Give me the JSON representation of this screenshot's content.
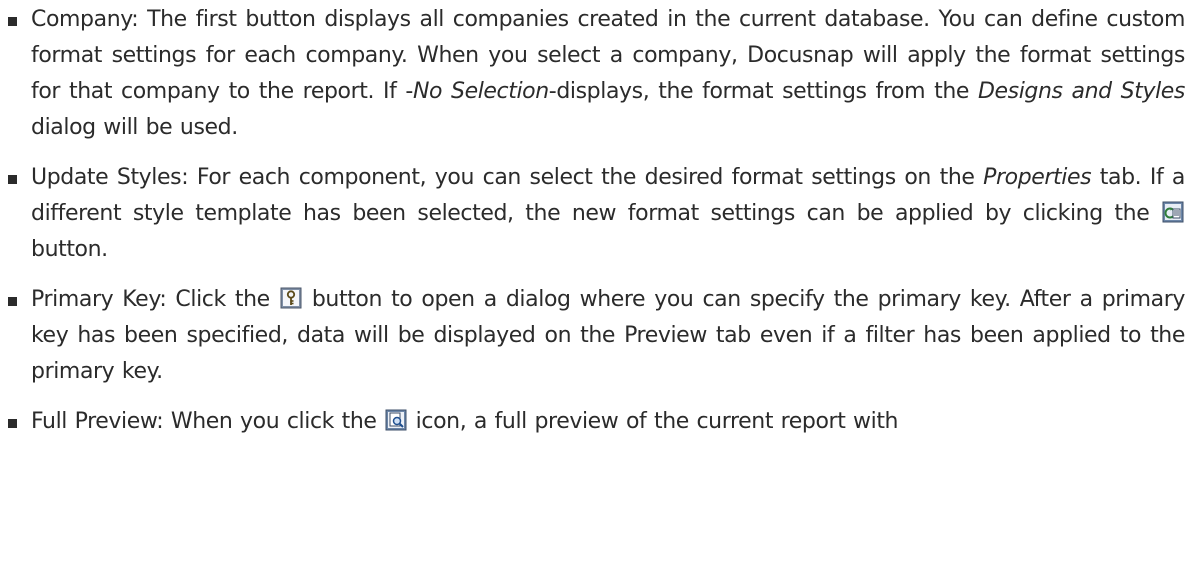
{
  "items": [
    {
      "label": "Company:",
      "text_1": "The first button displays all companies created in the current database. You can define custom format settings for each company. When you select a company, Docusnap will apply the format settings for that company to the report. If -",
      "em_1": "No Selection",
      "text_2": "-displays, the format settings from the ",
      "em_2": "Designs and Styles",
      "text_3": " dialog will be used."
    },
    {
      "label": "Update Styles:",
      "text_1": "For each component, you can select the desired format settings on the ",
      "em_1": "Properties",
      "text_2": " tab. If a different style template has been selected, the new format settings can be applied by clicking the ",
      "icon": "update-styles-icon",
      "text_3": " button."
    },
    {
      "label": "Primary Key:",
      "text_1": "Click the ",
      "icon": "primary-key-icon",
      "text_2": " button to open a dialog where you can specify the primary key. After a primary key has been specified, data will be displayed on the Preview tab even if a filter has been applied to the primary key."
    },
    {
      "label": "Full Preview:",
      "text_1": "When you click the ",
      "icon": "full-preview-icon",
      "text_2": " icon, a full preview of the current report with"
    }
  ]
}
